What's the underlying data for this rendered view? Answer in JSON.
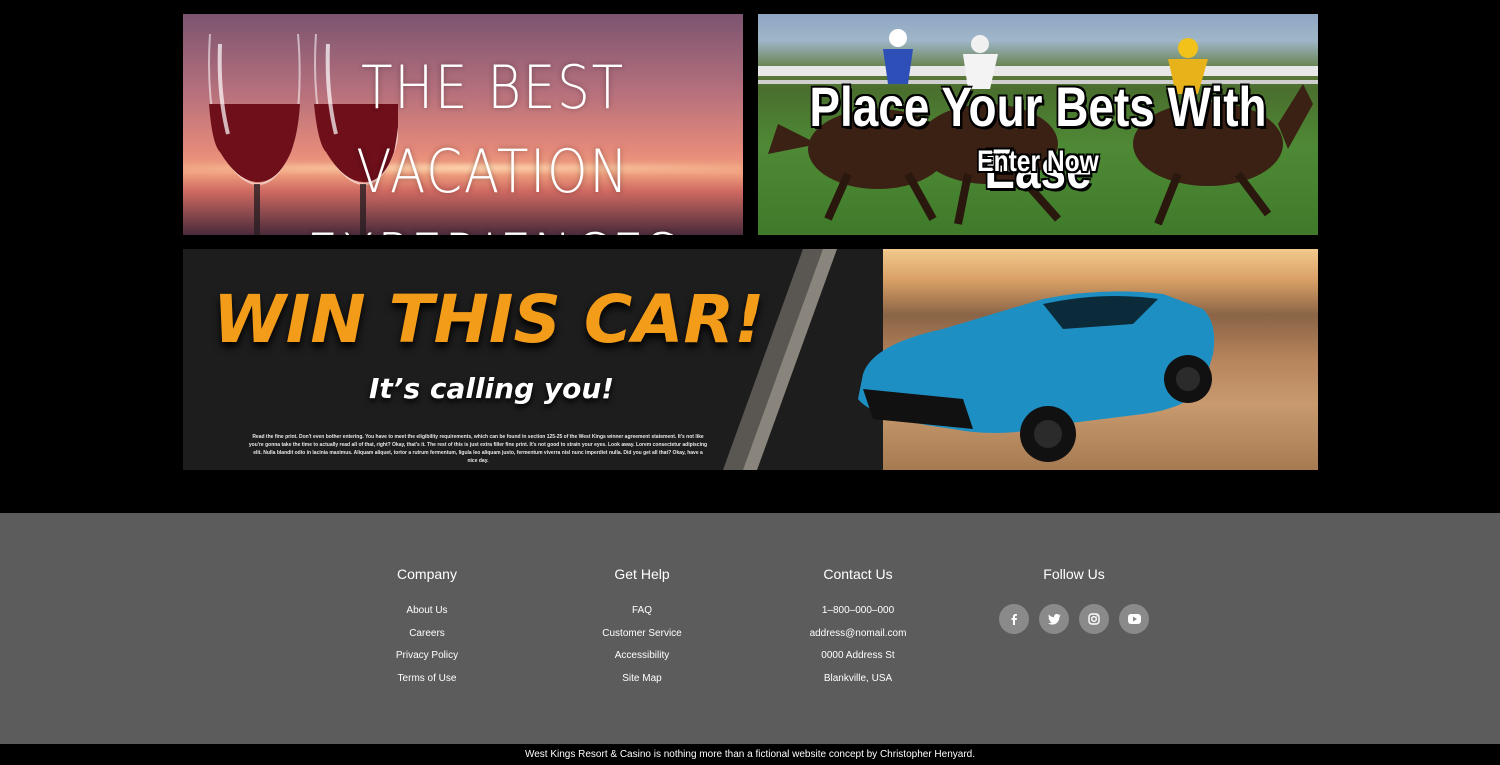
{
  "banners": {
    "vacation": {
      "line1": "THE BEST VACATION",
      "line2": "EXPERIENCES"
    },
    "bets": {
      "title": "Place Your Bets With Ease",
      "cta": "Enter Now"
    },
    "car": {
      "title": "WIN THIS CAR!",
      "subtitle": "It’s calling you!",
      "fine_print": "Read the fine print. Don't even bother entering. You have to meet the eligibility requirements, which can be found in section 125-25 of the West Kings winner agreement statement. It's not like you're gonna take the time to actually read all of that, right? Okay, that's it. The rest of this is just extra filler fine print. It's not good to strain your eyes. Look away. Lorem consectetur adipiscing elit. Nulla blandit odio in lacinia maximus. Aliquam aliquet, tortor a rutrum fermentum, ligula leo aliquam justo, fermentum viverra nisl nunc imperdiet nulla. Did you get all that? Okay, have a nice day."
    }
  },
  "footer": {
    "company": {
      "title": "Company",
      "links": [
        "About Us",
        "Careers",
        "Privacy Policy",
        "Terms of Use"
      ]
    },
    "help": {
      "title": "Get Help",
      "links": [
        "FAQ",
        "Customer Service",
        "Accessibility",
        "Site Map"
      ]
    },
    "contact": {
      "title": "Contact Us",
      "items": [
        "1–800–000–000",
        "address@nomail.com",
        "0000 Address St",
        "Blankville, USA"
      ]
    },
    "follow": {
      "title": "Follow Us",
      "icons": [
        "facebook-icon",
        "twitter-icon",
        "instagram-icon",
        "youtube-icon"
      ]
    },
    "copyright": "West Kings Resort & Casino is nothing more than a fictional website concept by Christopher Henyard."
  },
  "colors": {
    "background": "#000000",
    "footer": "#5c5c5c",
    "accent_orange": "#f39c1a",
    "social_circle": "#8a8a8a"
  }
}
